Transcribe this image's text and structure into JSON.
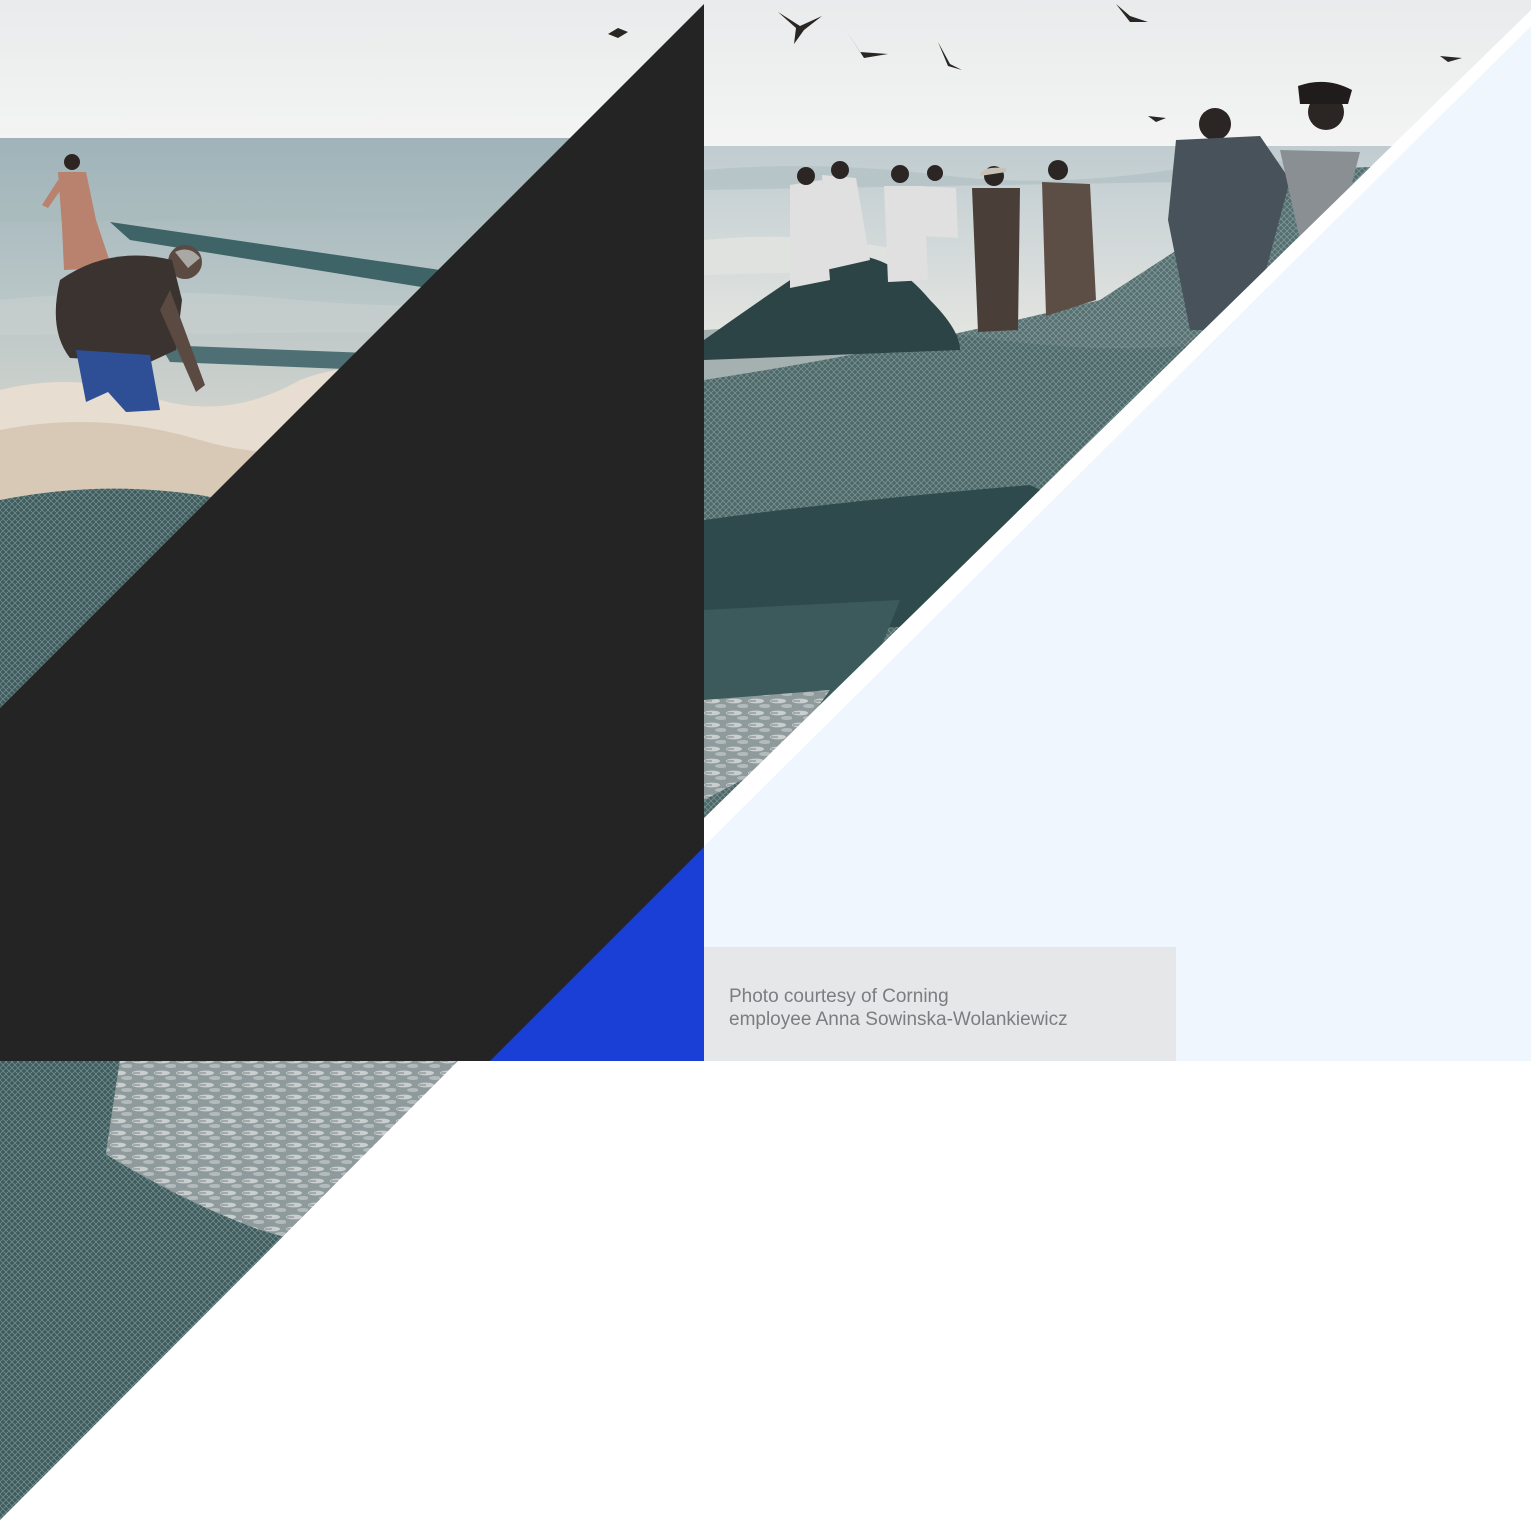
{
  "photo_left": {
    "description_icon": "fishermen-pulling-net-photo-icon"
  },
  "photo_right": {
    "description_icon": "fishermen-group-net-photo-icon"
  },
  "caption": {
    "line1": "Photo courtesy of Corning",
    "line2": "employee Anna Sowinska-Wolankiewicz"
  },
  "colors": {
    "dark_panel": "#242424",
    "accent_blue": "#1a3fd6",
    "light_panel": "#eff6fd",
    "caption_bg": "#e6e7e8",
    "caption_text": "#7b7d80"
  }
}
